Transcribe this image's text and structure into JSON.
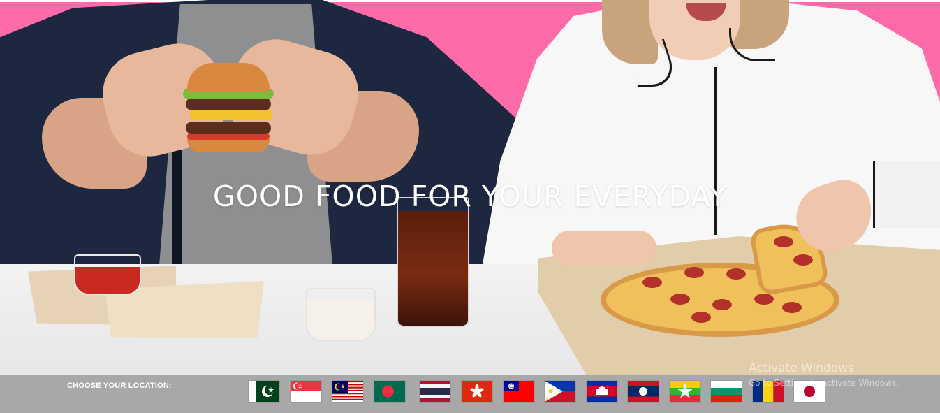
{
  "hero": {
    "title": "GOOD FOOD FOR YOUR EVERYDAY",
    "background_color": "#ff6aa9"
  },
  "location": {
    "label": "CHOOSE YOUR LOCATION:",
    "flags": [
      {
        "country": "Pakistan",
        "icon": "pakistan-flag-icon"
      },
      {
        "country": "Singapore",
        "icon": "singapore-flag-icon"
      },
      {
        "country": "Malaysia",
        "icon": "malaysia-flag-icon"
      },
      {
        "country": "Bangladesh",
        "icon": "bangladesh-flag-icon"
      },
      {
        "country": "Thailand",
        "icon": "thailand-flag-icon"
      },
      {
        "country": "Hong Kong",
        "icon": "hong-kong-flag-icon"
      },
      {
        "country": "Taiwan",
        "icon": "taiwan-flag-icon"
      },
      {
        "country": "Philippines",
        "icon": "philippines-flag-icon"
      },
      {
        "country": "Cambodia",
        "icon": "cambodia-flag-icon"
      },
      {
        "country": "Laos",
        "icon": "laos-flag-icon"
      },
      {
        "country": "Myanmar",
        "icon": "myanmar-flag-icon"
      },
      {
        "country": "Bulgaria",
        "icon": "bulgaria-flag-icon"
      },
      {
        "country": "Romania",
        "icon": "romania-flag-icon"
      },
      {
        "country": "Japan",
        "icon": "japan-flag-icon"
      }
    ],
    "bar_color": "#a8a8a8"
  },
  "watermark": {
    "line1": "Activate Windows",
    "line2": "Go to Settings to activate Windows."
  }
}
